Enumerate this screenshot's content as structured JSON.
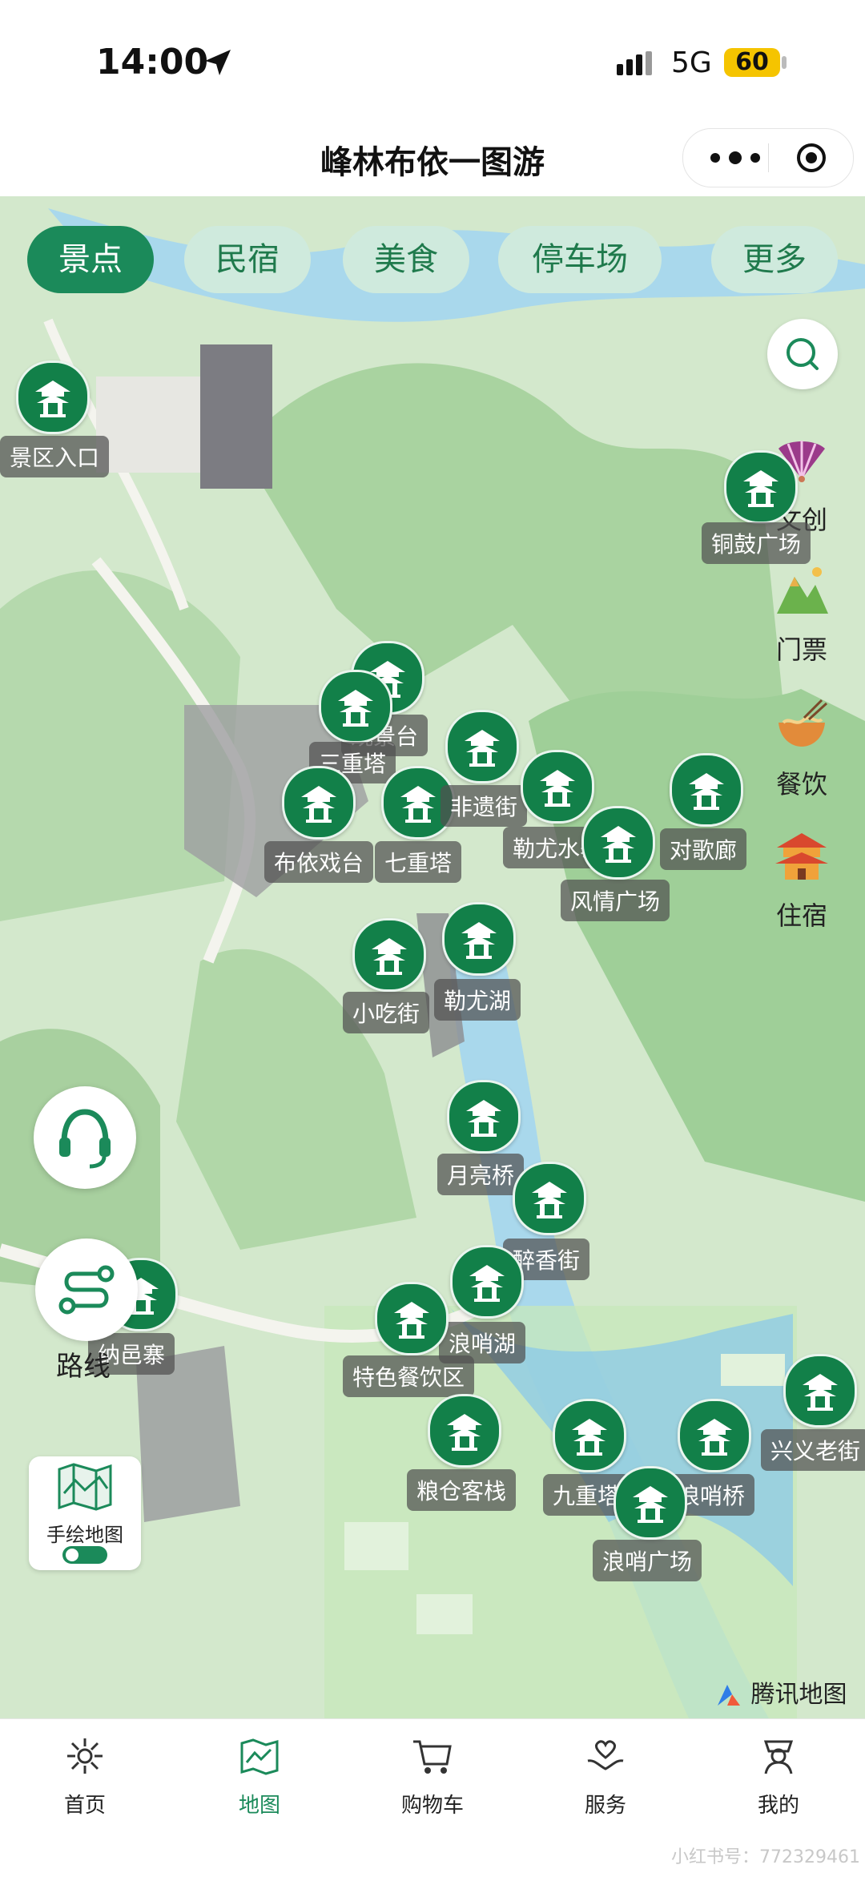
{
  "status_bar": {
    "time": "14:00",
    "network": "5G",
    "battery": "60"
  },
  "header": {
    "title": "峰林布依一图游"
  },
  "categories": {
    "chips": [
      {
        "label": "景点",
        "active": true
      },
      {
        "label": "民宿",
        "active": false
      },
      {
        "label": "美食",
        "active": false
      },
      {
        "label": "停车场",
        "active": false
      },
      {
        "label": "更多",
        "active": false
      }
    ]
  },
  "side_menu": {
    "items": [
      {
        "label": "文创",
        "icon": "fan-icon"
      },
      {
        "label": "门票",
        "icon": "ticket-mountain-icon"
      },
      {
        "label": "餐饮",
        "icon": "noodle-bowl-icon"
      },
      {
        "label": "住宿",
        "icon": "pagoda-icon"
      }
    ]
  },
  "places": [
    "景区入口",
    "铜鼓广场",
    "观景台",
    "三重塔",
    "布依戏台",
    "七重塔",
    "非遗街",
    "勒尤水寨",
    "风情广场",
    "对歌廊",
    "小吃街",
    "勒尤湖",
    "月亮桥",
    "醉香街",
    "浪哨湖",
    "纳邑寨",
    "特色餐饮区",
    "粮仓客栈",
    "九重塔",
    "浪哨桥",
    "浪哨广场",
    "兴义老街"
  ],
  "tools": {
    "route_label": "路线",
    "handdrawn_label": "手绘地图",
    "map_provider": "腾讯地图"
  },
  "tabbar": {
    "items": [
      {
        "label": "首页",
        "active": false
      },
      {
        "label": "地图",
        "active": true
      },
      {
        "label": "购物车",
        "active": false
      },
      {
        "label": "服务",
        "active": false
      },
      {
        "label": "我的",
        "active": false
      }
    ]
  },
  "watermark": "小红书号：772329461",
  "colors": {
    "accent": "#1b8a5a",
    "marker": "#128049",
    "chip_inactive": "#cfeadd",
    "water": "#a9d8ec"
  }
}
